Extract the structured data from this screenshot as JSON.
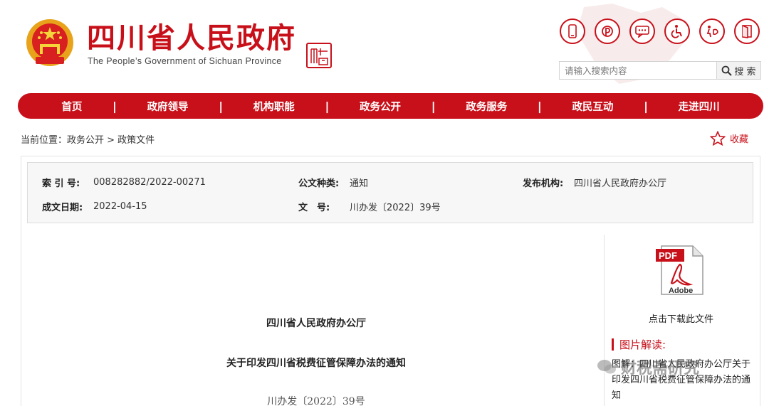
{
  "header": {
    "title": "四川省人民政府",
    "subtitle": "The People’s Government of Sichuan Province",
    "seal_text": "四川中國",
    "search_placeholder": "请输入搜索内容",
    "search_button": "搜 索",
    "tool_icons": [
      "mobile-icon",
      "weibo-icon",
      "message-icon",
      "accessibility-icon",
      "elderly-care-icon",
      "exit-icon"
    ],
    "brand_color": "#c8101a"
  },
  "nav": {
    "items": [
      "首页",
      "政府领导",
      "机构职能",
      "政务公开",
      "政务服务",
      "政民互动",
      "走进四川"
    ]
  },
  "breadcrumb": {
    "text": "当前位置：政务公开 > 政策文件"
  },
  "favorite": {
    "label": "收藏"
  },
  "meta": {
    "index_label": "索 引 号:",
    "index_value": "008282882/2022-00271",
    "category_label": "公文种类:",
    "category_value": "通知",
    "issuer_label": "发布机构:",
    "issuer_value": "四川省人民政府办公厅",
    "date_label": "成文日期:",
    "date_value": "2022-04-15",
    "docno_label": "文　号:",
    "docno_value": "川办发〔2022〕39号"
  },
  "document": {
    "issuer": "四川省人民政府办公厅",
    "title": "关于印发四川省税费征管保障办法的通知",
    "number": "川办发〔2022〕39号"
  },
  "sidebar": {
    "pdf_label": "PDF",
    "pdf_brand": "Adobe",
    "download_text": "点击下载此文件",
    "reading_title": "图片解读:",
    "reading_link": "图解：四川省人民政府办公厅关于印发四川省税费征管保障办法的通知"
  },
  "watermark": {
    "text": "财税斋研究"
  }
}
